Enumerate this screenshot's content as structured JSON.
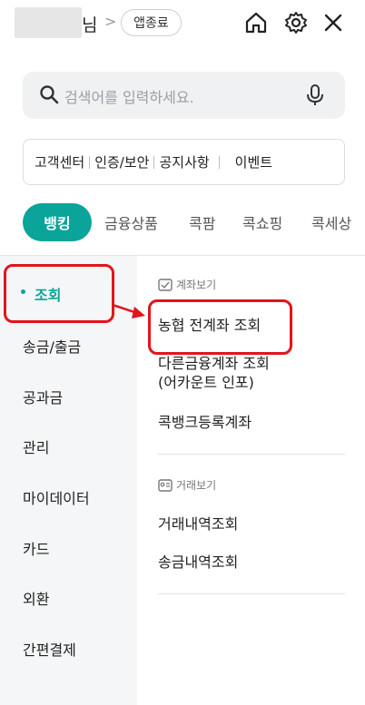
{
  "header": {
    "suffix": "님",
    "chevron": ">",
    "logout_label": "앱종료",
    "icons": [
      "home-icon",
      "gear-icon",
      "close-icon"
    ]
  },
  "search": {
    "placeholder": "검색어를 입력하세요.",
    "icon": "search-icon",
    "mic_icon": "mic-icon"
  },
  "quick_links": [
    "고객센터",
    "인증/보안",
    "공지사항",
    "이벤트"
  ],
  "tabs": [
    "뱅킹",
    "금융상품",
    "콕팜",
    "콕쇼핑",
    "콕세상"
  ],
  "left_menu": [
    "조회",
    "송금/출금",
    "공과금",
    "관리",
    "마이데이터",
    "카드",
    "외환",
    "간편결제"
  ],
  "content": {
    "section1": {
      "title": "계좌보기",
      "items": [
        "농협 전계좌 조회",
        "다른금융계좌 조회\n(어카운트 인포)",
        "콕뱅크등록계좌"
      ]
    },
    "section2": {
      "title": "거래보기",
      "items": [
        "거래내역조회",
        "송금내역조회"
      ]
    }
  },
  "colors": {
    "accent": "#0aa49a",
    "annotation_red": "#e3141b"
  }
}
